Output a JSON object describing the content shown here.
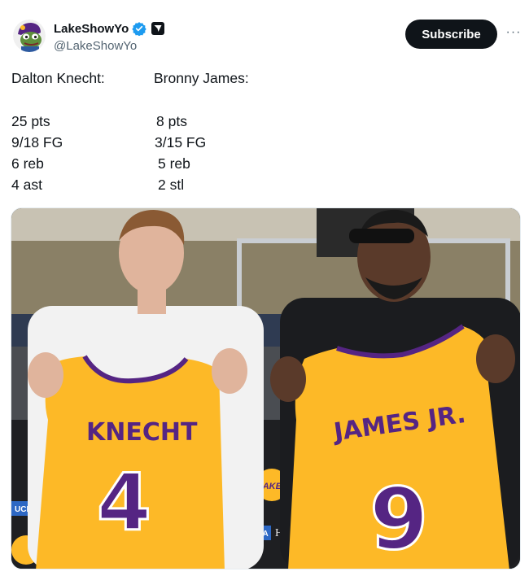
{
  "tweet": {
    "display_name": "LakeShowYo",
    "handle": "@LakeShowYo",
    "subscribe_label": "Subscribe",
    "more_label": "···",
    "stats": {
      "player1": {
        "name": "Dalton Knecht:",
        "lines": [
          "25 pts",
          "9/18 FG",
          "6 reb",
          "4 ast"
        ]
      },
      "player2": {
        "name": "Bronny James:",
        "lines": [
          "8 pts",
          "3/15 FG",
          "5 reb",
          "2 stl"
        ]
      }
    },
    "photo": {
      "jersey_left_name": "KNECHT",
      "jersey_left_number": "4",
      "jersey_right_name": "JAMES JR.",
      "jersey_right_number": "9",
      "backdrop_texts": [
        "UCLA",
        "Health",
        "LAKERS"
      ]
    }
  },
  "colors": {
    "verified_blue": "#1d9bf0",
    "lakers_gold": "#fdb927",
    "lakers_purple": "#552583",
    "button_black": "#0f1419",
    "secondary_text": "#536471"
  },
  "icons": {
    "avatar": "frog-avatar",
    "verified": "verified-badge-icon",
    "affiliate": "affiliate-badge-icon",
    "more": "more-options-icon"
  }
}
